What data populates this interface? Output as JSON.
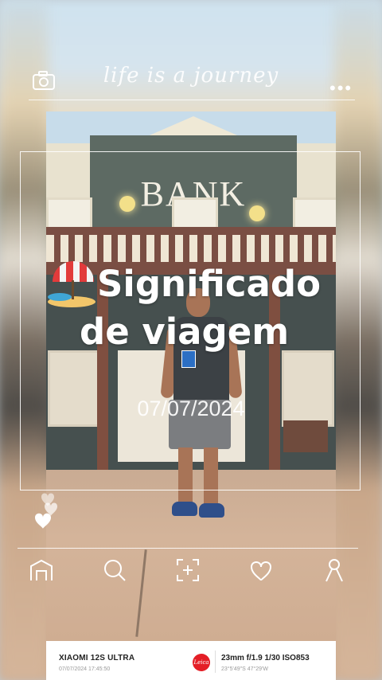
{
  "header": {
    "tagline": "life is a journey",
    "camera_icon": "camera-icon",
    "more_icon": "more-dots-icon",
    "more_label": "•••"
  },
  "photo": {
    "sign_text": "BANK"
  },
  "overlay": {
    "title_line1": "Significado",
    "title_line2": "de viagem",
    "emoji": "beach-umbrella-emoji",
    "date": "07/07/2024"
  },
  "nav": {
    "items": [
      {
        "icon": "home-icon"
      },
      {
        "icon": "search-icon"
      },
      {
        "icon": "add-icon"
      },
      {
        "icon": "heart-icon"
      },
      {
        "icon": "profile-icon"
      }
    ]
  },
  "exif": {
    "model": "XIAOMI 12S ULTRA",
    "datetime": "07/07/2024  17:45:50",
    "logo": "Leica",
    "params": "23mm  f/1.9  1/30  ISO853",
    "gps": "23°5'49\"S  47°29'W"
  },
  "colors": {
    "accent_red": "#e41e26",
    "overlay_white": "#ffffff"
  }
}
